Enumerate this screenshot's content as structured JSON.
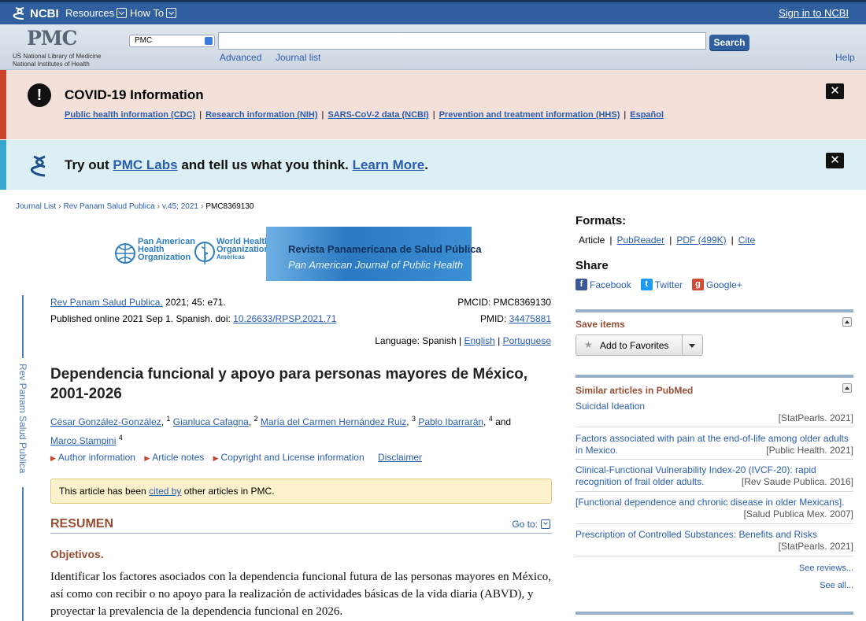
{
  "ncbi_bar": {
    "logo_text": "NCBI",
    "resources": "Resources",
    "howto": "How To",
    "signin": "Sign in to NCBI"
  },
  "pmc_header": {
    "logo": "PMC",
    "sub1": "US National Library of Medicine",
    "sub2": "National Institutes of Health",
    "db_selected": "PMC",
    "search_value": "",
    "search_button": "Search",
    "advanced": "Advanced",
    "journal_list": "Journal list",
    "help": "Help"
  },
  "covid": {
    "icon": "!",
    "title": "COVID-19 Information",
    "links": [
      "Public health information (CDC)",
      "Research information (NIH)",
      "SARS-CoV-2 data (NCBI)",
      "Prevention and treatment information (HHS)",
      "Español"
    ],
    "sep": "|"
  },
  "labs": {
    "t1": "Try out ",
    "l1": "PMC Labs",
    "t2": " and tell us what you think. ",
    "l2": "Learn More",
    "t3": "."
  },
  "close_label": "✕",
  "breadcrumb": {
    "items": [
      "Journal List",
      "Rev Panam Salud Publica",
      "v.45; 2021",
      "PMC8369130"
    ],
    "sep": "›"
  },
  "journal_banner": {
    "org1a": "Pan American",
    "org1b": "Health",
    "org1c": "Organization",
    "org2a": "World Health",
    "org2b": "Organization",
    "org2c": "Americas",
    "jtitle": "Revista Panamericana de Salud Pública",
    "jsub": "Pan American Journal of Public Health"
  },
  "side_strip_text": "Rev Panam Salud Publica",
  "citation": {
    "journal": "Rev Panam Salud Publica.",
    "vol": " 2021; 45: e71.",
    "published": "Published online 2021 Sep 1. Spanish. doi: ",
    "doi": "10.26633/RPSP.2021.71",
    "pmcid": "PMCID: PMC8369130",
    "pmid_label": "PMID: ",
    "pmid": "34475881",
    "language_label": "Language: Spanish | ",
    "lang_en": "English",
    "lang_sep": " | ",
    "lang_pt": "Portuguese"
  },
  "article": {
    "title": "Dependencia funcional y apoyo para personas mayores de México, 2001-2026",
    "authors": [
      {
        "name": "César González-González",
        "sup": "1"
      },
      {
        "name": "Gianluca Cafagna",
        "sup": "2"
      },
      {
        "name": "María del Carmen Hernández Ruiz",
        "sup": "3"
      },
      {
        "name": "Pablo Ibarrarán",
        "sup": "4"
      },
      {
        "name": "Marco Stampini",
        "sup": "4"
      }
    ],
    "and": "and",
    "info_links": [
      "Author information",
      "Article notes",
      "Copyright and License information"
    ],
    "disclaimer": "Disclaimer",
    "cited_pre": "This article has been ",
    "cited_link": "cited by",
    "cited_post": " other articles in PMC.",
    "resumen": "RESUMEN",
    "goto": "Go to:",
    "objetivos": "Objetivos.",
    "abstract": "Identificar los factores asociados con la dependencia funcional futura de las personas mayores en México, así como con recibir o no apoyo para la realización de actividades básicas de la vida diaria (ABVD), y proyectar la prevalencia de la dependencia funcional en 2026."
  },
  "sidebar": {
    "formats_title": "Formats:",
    "formats": [
      "Article",
      "PubReader",
      "PDF (499K)",
      "Cite"
    ],
    "share_title": "Share",
    "share": [
      "Facebook",
      "Twitter",
      "Google+"
    ],
    "save_title": "Save items",
    "add_fav": "Add to Favorites",
    "similar_title": "Similar articles in PubMed",
    "similar": [
      {
        "title": "Suicidal Ideation",
        "source": "[StatPearls. 2021]"
      },
      {
        "title": "Factors associated with pain at the end-of-life among older adults in Mexico.",
        "source": "[Public Health. 2021]"
      },
      {
        "title": "Clinical-Functional Vulnerability Index-20 (IVCF-20): rapid recognition of frail older adults.",
        "source": "[Rev Saude Publica. 2016]"
      },
      {
        "title": "[Functional dependence and chronic disease in older Mexicans].",
        "source": "[Salud Publica Mex. 2007]"
      },
      {
        "title": "Prescription of Controlled Substances: Benefits and Risks",
        "source": "[StatPearls. 2021]"
      }
    ],
    "see_reviews": "See reviews...",
    "see_all": "See all..."
  },
  "colors": {
    "ncbi_blue": "#2f5f9e",
    "covid_accent": "#c9432b",
    "labs_accent": "#35a7cf",
    "section_brown": "#974e33",
    "link": "#2a5db0"
  }
}
